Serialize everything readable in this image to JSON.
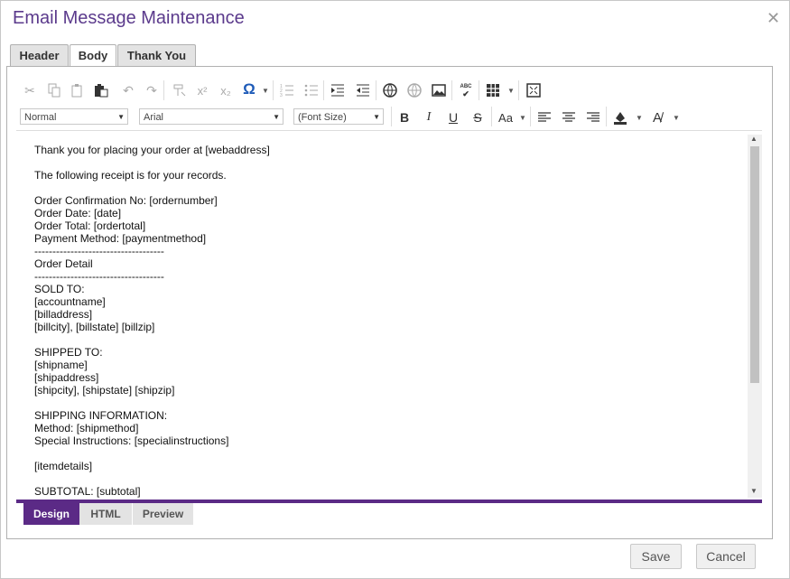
{
  "dialog": {
    "title": "Email Message Maintenance"
  },
  "tabs": [
    {
      "label": "Header"
    },
    {
      "label": "Body"
    },
    {
      "label": "Thank You"
    }
  ],
  "toolbar": {
    "paragraph_style": "Normal",
    "font_name": "Arial",
    "font_size": "(Font Size)",
    "bold": "B",
    "italic": "I",
    "underline": "U",
    "strike": "S",
    "case": "Aa",
    "omega": "Ω"
  },
  "editor": {
    "lines": [
      "Thank you for placing your order at [webaddress]",
      "",
      "The following receipt is for your records.",
      "",
      "Order Confirmation No: [ordernumber]",
      "Order Date: [date]",
      "Order Total: [ordertotal]",
      "Payment Method: [paymentmethod]",
      "------------------------------------",
      "Order Detail",
      "------------------------------------",
      "SOLD TO:",
      "[accountname]",
      "[billaddress]",
      "[billcity], [billstate] [billzip]",
      "",
      "SHIPPED TO:",
      "[shipname]",
      "[shipaddress]",
      "[shipcity], [shipstate] [shipzip]",
      "",
      "SHIPPING INFORMATION:",
      "Method: [shipmethod]",
      "Special Instructions: [specialinstructions]",
      "",
      "[itemdetails]",
      "",
      "SUBTOTAL: [subtotal]"
    ]
  },
  "mode_tabs": [
    {
      "label": "Design"
    },
    {
      "label": "HTML"
    },
    {
      "label": "Preview"
    }
  ],
  "footer": {
    "save_label": "Save",
    "cancel_label": "Cancel"
  },
  "colors": {
    "accent": "#5b2a86",
    "title": "#5b3a8c",
    "omega": "#1e5bb8"
  }
}
